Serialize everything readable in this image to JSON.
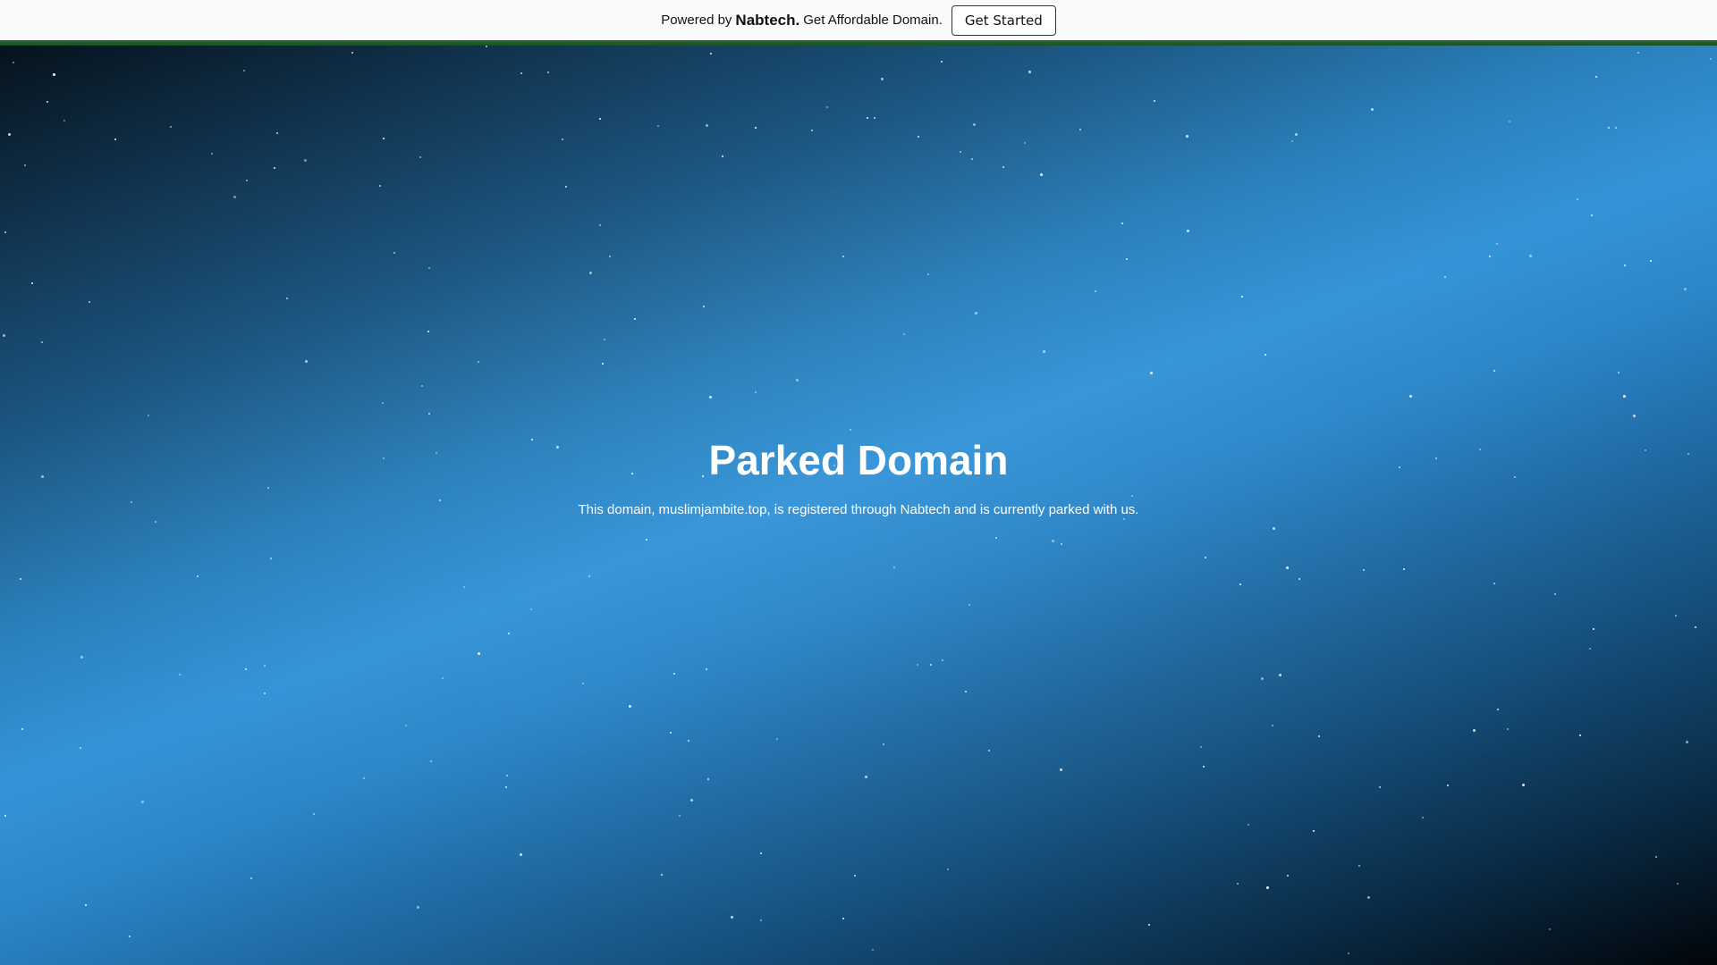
{
  "topbar": {
    "powered_by": "Powered by",
    "brand": "Nabtech.",
    "tagline": "Get Affordable Domain.",
    "cta_label": "Get Started",
    "stripe_color": "#1f5c2a"
  },
  "main": {
    "title": "Parked Domain",
    "description": "This domain, muslimjambite.top, is registered through Nabtech and is currently parked with us."
  },
  "background": {
    "style": "starry-sky",
    "colors": [
      "#06121c",
      "#3494d8",
      "#010509"
    ]
  }
}
